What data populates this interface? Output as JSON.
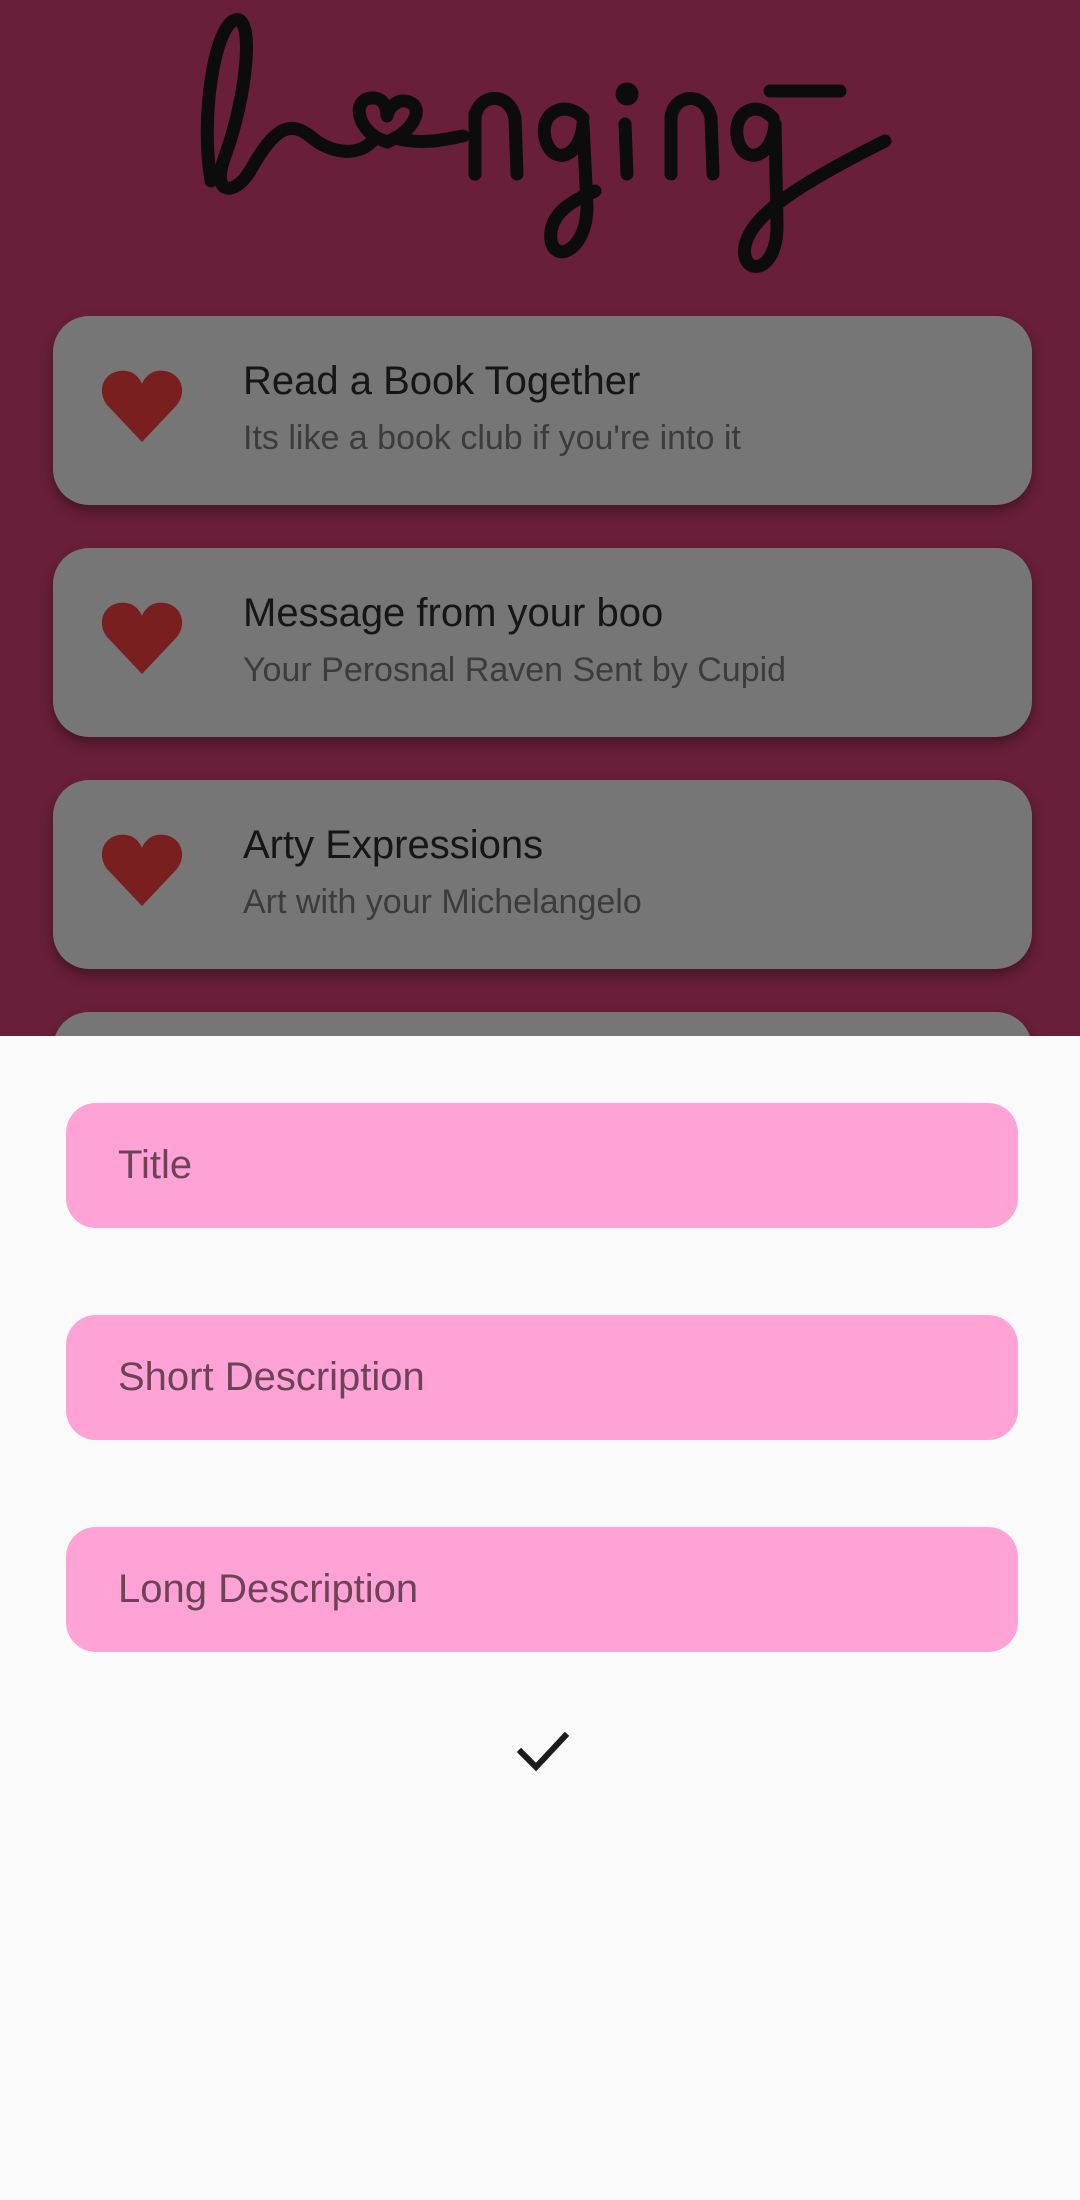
{
  "colors": {
    "background": "#691f39",
    "card": "#767676",
    "heart": "#7a1f1f",
    "field": "#ffa2d6",
    "sheet": "#fafafa"
  },
  "app": {
    "logo_text": "longing"
  },
  "activities": [
    {
      "icon": "heart-icon",
      "title": "Read a Book Together",
      "subtitle": "Its like a book club if you're into it"
    },
    {
      "icon": "heart-icon",
      "title": "Message from your boo",
      "subtitle": "Your Perosnal Raven Sent by Cupid"
    },
    {
      "icon": "heart-icon",
      "title": "Arty Expressions",
      "subtitle": "Art with your Michelangelo"
    }
  ],
  "form": {
    "title_placeholder": "Title",
    "short_description_placeholder": "Short Description",
    "long_description_placeholder": "Long Description",
    "submit_icon": "check-icon"
  }
}
